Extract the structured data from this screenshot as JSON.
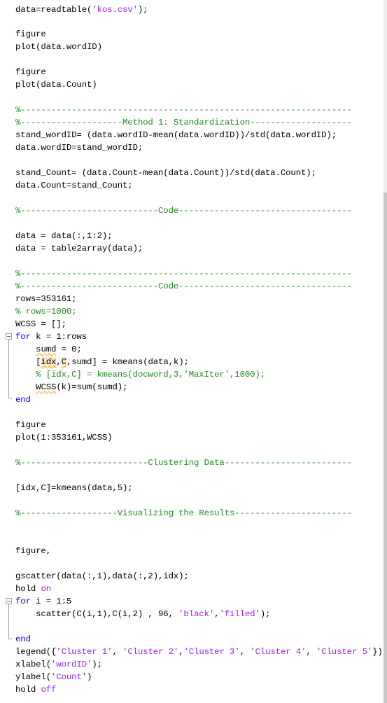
{
  "editor": {
    "lines": {
      "l1": {
        "a": "data=readtable(",
        "s": "'kos.csv'",
        "b": ");"
      },
      "l2": "figure",
      "l3": "plot(data.wordID)",
      "l4": "figure",
      "l5": "plot(data.Count)",
      "l6": "%-----------------------------------------------------------------",
      "l7": "%--------------------Method 1: Standardization--------------------",
      "l8": "stand_wordID= (data.wordID-mean(data.wordID))/std(data.wordID);",
      "l9": "data.wordID=stand_wordID;",
      "l10": "stand_Count= (data.Count-mean(data.Count))/std(data.Count);",
      "l11": "data.Count=stand_Count;",
      "l12": "%---------------------------Code----------------------------------",
      "l13": "data = data(:,1:2);",
      "l14": "data = table2array(data);",
      "l15": "%-----------------------------------------------------------------",
      "l16": "%---------------------------Code----------------------------------",
      "l17": "rows=353161;",
      "l18": "% rows=1000;",
      "l19": "WCSS = [];",
      "l20": {
        "kw": "for",
        "rest": " k = 1:rows"
      },
      "l21": {
        "indent": "    ",
        "sq": "sumd",
        "rest": " = 0;"
      },
      "l22": {
        "indent": "    ",
        "a": "[",
        "h1": "idx",
        "c1": ",",
        "h2": "C",
        "b": ",sumd] = kmeans(data,k);"
      },
      "l23": "    % [idx,C] = kmeans(docword,3,'MaxIter',1000);",
      "l24": {
        "indent": "    ",
        "sq": "WCSS",
        "rest": "(k)=sum(sumd);"
      },
      "l25": "end",
      "l26": "figure",
      "l27": "plot(1:353161,WCSS)",
      "l28": "%-------------------------Clustering Data-------------------------",
      "l29": "[idx,C]=kmeans(data,5);",
      "l30": "%-------------------Visualizing the Results-----------------------",
      "l31": "figure,",
      "l32": "gscatter(data(:,1),data(:,2),idx);",
      "l33": {
        "a": "hold ",
        "s": "on"
      },
      "l34": {
        "kw": "for",
        "rest": " i = 1:5"
      },
      "l35": {
        "a": "    scatter(C(i,1),C(i,2) , 96, ",
        "s1": "'black'",
        "c": ",",
        "s2": "'filled'",
        "b": ");"
      },
      "l36": "end",
      "l37": {
        "a": "legend({",
        "s1": "'Cluster 1'",
        "c1": ", ",
        "s2": "'Cluster 2'",
        "c2": ",",
        "s3": "'Cluster 3'",
        "c3": ", ",
        "s4": "'Cluster 4'",
        "c4": ", ",
        "s5": "'Cluster 5'",
        "b": "})"
      },
      "l38": {
        "a": "xlabel(",
        "s": "'wordID'",
        "b": ");"
      },
      "l39": {
        "a": "ylabel(",
        "s": "'Count'",
        "b": ")"
      },
      "l40": {
        "a": "hold ",
        "s": "off"
      }
    }
  }
}
